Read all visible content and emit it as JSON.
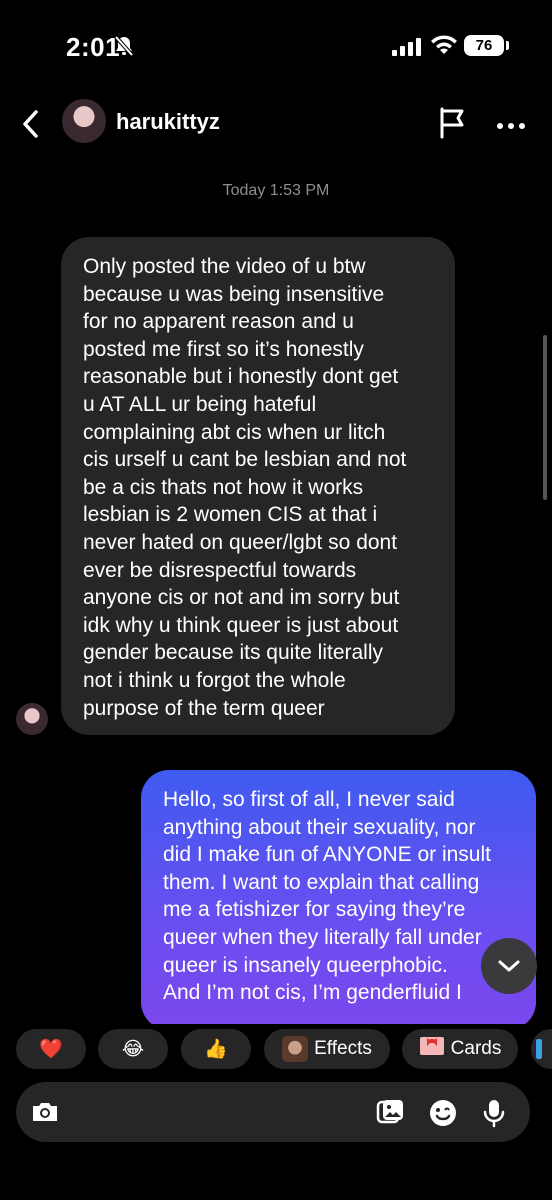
{
  "status_bar": {
    "time": "2:01",
    "battery": "76"
  },
  "header": {
    "username": "harukittyz"
  },
  "timestamp": "Today 1:53 PM",
  "incoming_message": {
    "lines": [
      "Only posted the video of u btw",
      "because u was being insensitive",
      "for no apparent reason and u",
      "posted me first so it’s honestly",
      "reasonable but i honestly dont get",
      "u AT ALL ur being hateful",
      "complaining abt cis when ur litch",
      "cis urself u cant be lesbian and not",
      "be a cis thats not how it works",
      "lesbian is 2 women CIS at that i",
      "never hated on queer/lgbt so dont",
      "ever be disrespectful towards",
      "anyone cis or not and im sorry but",
      "idk why u think queer is just about",
      "gender because its quite literally",
      "not i think u forgot the whole",
      "purpose of the term queer"
    ]
  },
  "outgoing_message": {
    "lines": [
      "Hello, so first of all, I never said",
      "anything about their sexuality, nor",
      "did I make fun of ANYONE or insult",
      "them. I want to explain that calling",
      "me a fetishizer for saying they’re",
      "queer when they literally fall under",
      "queer is insanely queerphobic.",
      "And I’m not cis, I’m genderfluid I"
    ]
  },
  "reactions": [
    {
      "emoji": "❤️",
      "label": ""
    },
    {
      "emoji": "😂",
      "label": ""
    },
    {
      "emoji": "👍",
      "label": ""
    },
    {
      "emoji": "",
      "label": "Effects"
    },
    {
      "emoji": "",
      "label": "Cards"
    }
  ]
}
